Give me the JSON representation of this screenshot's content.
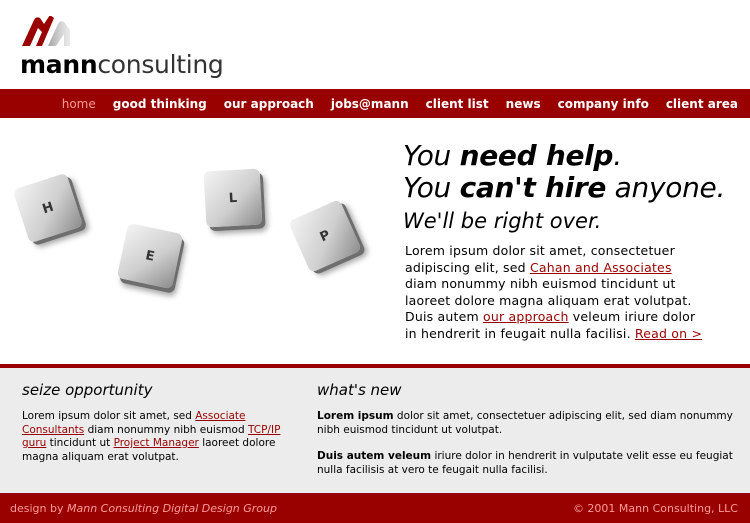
{
  "logo": {
    "bold": "mann",
    "light": "consulting"
  },
  "nav": {
    "items": [
      {
        "label": "home",
        "active": true
      },
      {
        "label": "good thinking"
      },
      {
        "label": "our approach"
      },
      {
        "label": "jobs@mann"
      },
      {
        "label": "client list"
      },
      {
        "label": "news"
      },
      {
        "label": "company info"
      },
      {
        "label": "client area"
      }
    ]
  },
  "hero": {
    "keys": [
      "H",
      "E",
      "L",
      "P"
    ],
    "tagline": {
      "l1_pre": "You ",
      "l1_bold": "need help",
      "l1_post": ".",
      "l2_pre": "You ",
      "l2_bold": "can't hire",
      "l2_post": " anyone.",
      "l3": "We'll be right over."
    },
    "body": {
      "t1": "Lorem ipsum dolor sit amet, consectetuer adipiscing elit, sed ",
      "link1": "Cahan and Associates",
      "t2": " diam nonummy nibh euismod tincidunt ut laoreet dolore magna aliquam erat volutpat. Duis autem ",
      "link2": "our approach",
      "t3": " veleum iriure dolor in hendrerit in feugait nulla facilisi. ",
      "link3": "Read on >"
    }
  },
  "seize": {
    "title": "seize opportunity",
    "t1": "Lorem ipsum dolor sit amet, sed ",
    "link1": "Associate Consultants",
    "t2": " diam nonummy nibh euismod ",
    "link2": "TCP/IP guru",
    "t3": " tincidunt ut ",
    "link3": "Project Manager",
    "t4": " laoreet dolore magna aliquam erat volutpat."
  },
  "whatsnew": {
    "title": "what's new",
    "p1_bold": "Lorem ipsum",
    "p1_text": " dolor sit amet, consectetuer adipiscing elit, sed diam nonummy nibh euismod tincidunt ut volutpat.",
    "p2_bold": "Duis autem veleum",
    "p2_text": " iriure dolor in hendrerit in vulputate velit esse eu feugiat nulla facilisis at vero te feugait nulla facilisi."
  },
  "footer": {
    "left_prefix": "design by ",
    "left_italic": "Mann Consulting Digital Design Group",
    "right": "© 2001 Mann Consulting, LLC"
  },
  "colors": {
    "brand_red": "#990000",
    "nav_active": "#ff9a9a",
    "lower_bg": "#ececec"
  }
}
